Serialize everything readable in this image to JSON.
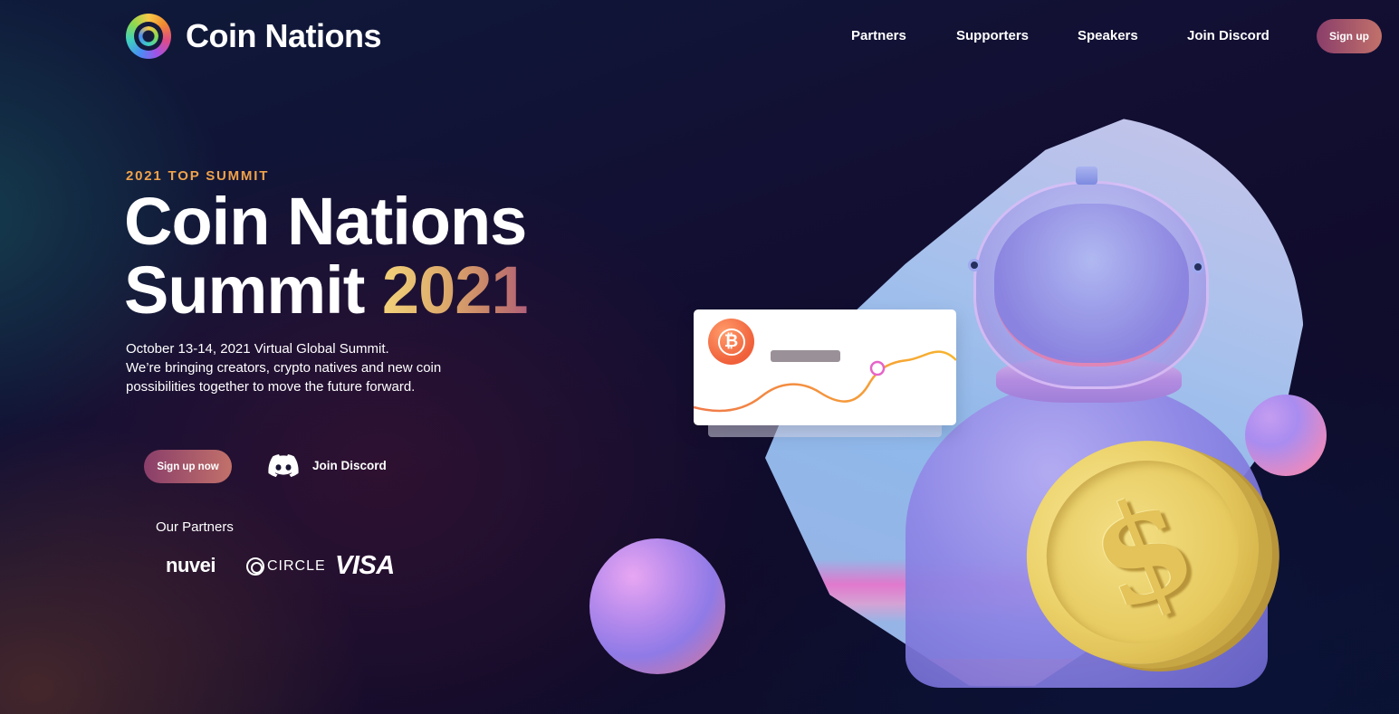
{
  "brand": {
    "name": "Coin Nations",
    "logo_icon": "coin-nations-logo-icon"
  },
  "nav": {
    "links": [
      "Partners",
      "Supporters",
      "Speakers",
      "Join Discord"
    ],
    "signup_label": "Sign up"
  },
  "hero": {
    "eyebrow": "2021 TOP SUMMIT",
    "title_line1": "Coin Nations",
    "title_line2_prefix": "Summit",
    "title_year": "2021",
    "description_line1": "October 13-14, 2021 Virtual Global Summit.",
    "description_line2": "We’re bringing creators, crypto natives and new coin possibilities together to move the future forward.",
    "cta_primary": "Sign up now",
    "cta_discord": "Join Discord"
  },
  "partners": {
    "title": "Our Partners",
    "logos": [
      "nuvei",
      "CIRCLE",
      "VISA"
    ]
  },
  "illustration": {
    "card_coin_symbol": "₿",
    "coin_symbol": "$"
  },
  "colors": {
    "accent_orange": "#f0a24a",
    "button_gradient_start": "#8a3e6a",
    "button_gradient_end": "#c2716a",
    "background": "#120f33"
  }
}
